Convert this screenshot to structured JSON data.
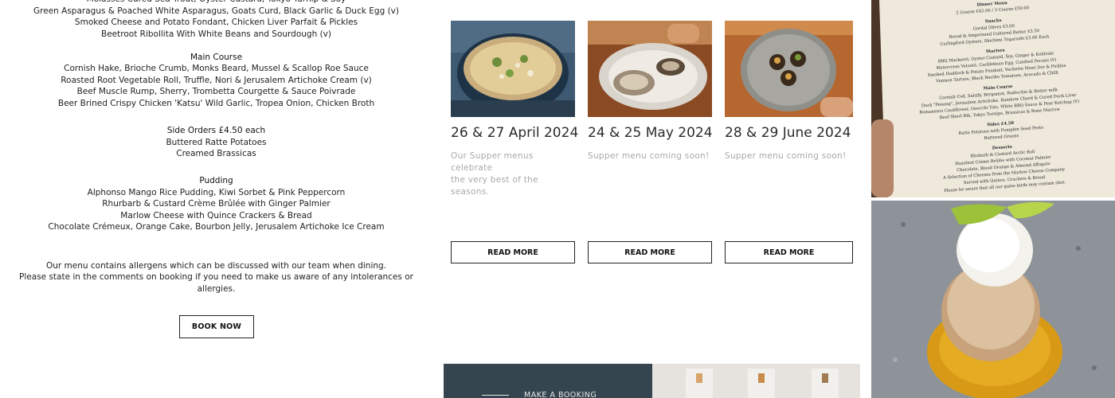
{
  "menu": {
    "lines": [
      {
        "text": "Molasses Cured Sea Trout, Oyster Custard, Tokyo Turnip & Soy",
        "heading": false
      },
      {
        "text": "Green Asparagus & Poached White Asparagus, Goats Curd, Black Garlic & Duck Egg (v)",
        "heading": false
      },
      {
        "text": "Smoked Cheese and Potato Fondant, Chicken Liver Parfait & Pickles",
        "heading": false
      },
      {
        "text": "Beetroot Ribollita With White Beans and Sourdough (v)",
        "heading": false
      },
      {
        "text": "Main Course",
        "heading": true
      },
      {
        "text": "Cornish Hake, Brioche Crumb, Monks Beard, Mussel & Scallop Roe Sauce",
        "heading": false
      },
      {
        "text": "Roasted Root Vegetable Roll, Truffle, Nori & Jerusalem Artichoke Cream (v)",
        "heading": false
      },
      {
        "text": "Beef Muscle Rump, Sherry, Trombetta Courgette & Sauce Poivrade",
        "heading": false
      },
      {
        "text": "Beer Brined Crispy Chicken 'Katsu' Wild Garlic, Tropea Onion, Chicken Broth",
        "heading": false
      },
      {
        "text": "Side Orders £4.50 each",
        "heading": true
      },
      {
        "text": "Buttered Ratte Potatoes",
        "heading": false
      },
      {
        "text": "Creamed Brassicas",
        "heading": false
      },
      {
        "text": "Pudding",
        "heading": true
      },
      {
        "text": "Alphonso Mango Rice Pudding, Kiwi Sorbet & Pink Peppercorn",
        "heading": false
      },
      {
        "text": "Rhurbarb & Custard Crème Brûlée with Ginger Palmier",
        "heading": false
      },
      {
        "text": "Marlow Cheese with Quince Crackers & Bread",
        "heading": false
      },
      {
        "text": "Chocolate Crémeux, Orange Cake, Bourbon Jelly, Jerusalem Artichoke Ice Cream",
        "heading": false
      },
      {
        "text": "Our menu contains allergens which can be discussed with our team when dining.",
        "heading": false
      },
      {
        "text": "Please state in the comments on booking if you need to make us aware of any intolerances or",
        "heading": false
      },
      {
        "text": "allergies.",
        "heading": false
      }
    ],
    "book_now": "BOOK NOW"
  },
  "events": [
    {
      "date": "26 & 27 April 2024",
      "desc_lines": [
        "Our Supper menus celebrate",
        "the very best of the seasons."
      ],
      "read_more": "READ MORE",
      "photo_icon": "risotto-bowl-photo"
    },
    {
      "date": "24 & 25 May 2024",
      "desc_lines": [
        "Supper menu coming soon!"
      ],
      "read_more": "READ MORE",
      "photo_icon": "oyster-plate-photo"
    },
    {
      "date": "28 & 29 June 2024",
      "desc_lines": [
        "Supper menu coming soon!"
      ],
      "read_more": "READ MORE",
      "photo_icon": "canape-plate-photo"
    }
  ],
  "booking_strip": {
    "label": "MAKE A BOOKING"
  },
  "menu_photo": {
    "lines": [
      "Dinner Menu",
      "2 Course £42.00 / 3 Course £50.00",
      "Snacks",
      "Gordal Olives £3.00",
      "Bread & Ampersand Cultured Butter £3.50",
      "Carlingford Oysters, Shichimi Togarashi £3.00 Each",
      "Starters",
      "BBQ Mackerel, Oyster Custard, Soy, Ginger & Kohlrabi",
      "Watercress Velouté, Cacklebean Egg, Candied Pecans (V)",
      "Smoked Haddock & Potato Fondant, Vacherin Mont Dor & Pickles",
      "Venison Tartare, Black Iberiko Tomatoes, Avocado & Chilli",
      "Main Course",
      "Cornish Cod, Salsify, Bergamot, Radicchio & Butter milk",
      "Duck \"Penang\", Jerusalem Artichoke, Rainbow Chard & Cured Duck Liver",
      "Romanesco Cauliflower, Gnocchi Tots, White BBQ Sauce & Pear Ketchup (V)",
      "Beef Short Rib, Tokyo Turnips, Brassicas & Bone Marrow",
      "Sides £4.50",
      "Ratte Potatoes with Pumpkin Seed Pesto",
      "Buttered Greens",
      "Desserts",
      "Rhubarb & Custard Arctic Roll",
      "Hazelnut Crème Brûlée with Coconut Palmier",
      "Chocolate, Blood Orange & Almond Affogato",
      "A Selection of Cheeses from the Marlow Cheese Company",
      "Served with Quince, Crackers & Bread",
      "Please be aware that all our game birds may contain shot."
    ]
  },
  "colors": {
    "booking_strip_bg": "#35454f",
    "muted_text": "#a8a8a8"
  }
}
